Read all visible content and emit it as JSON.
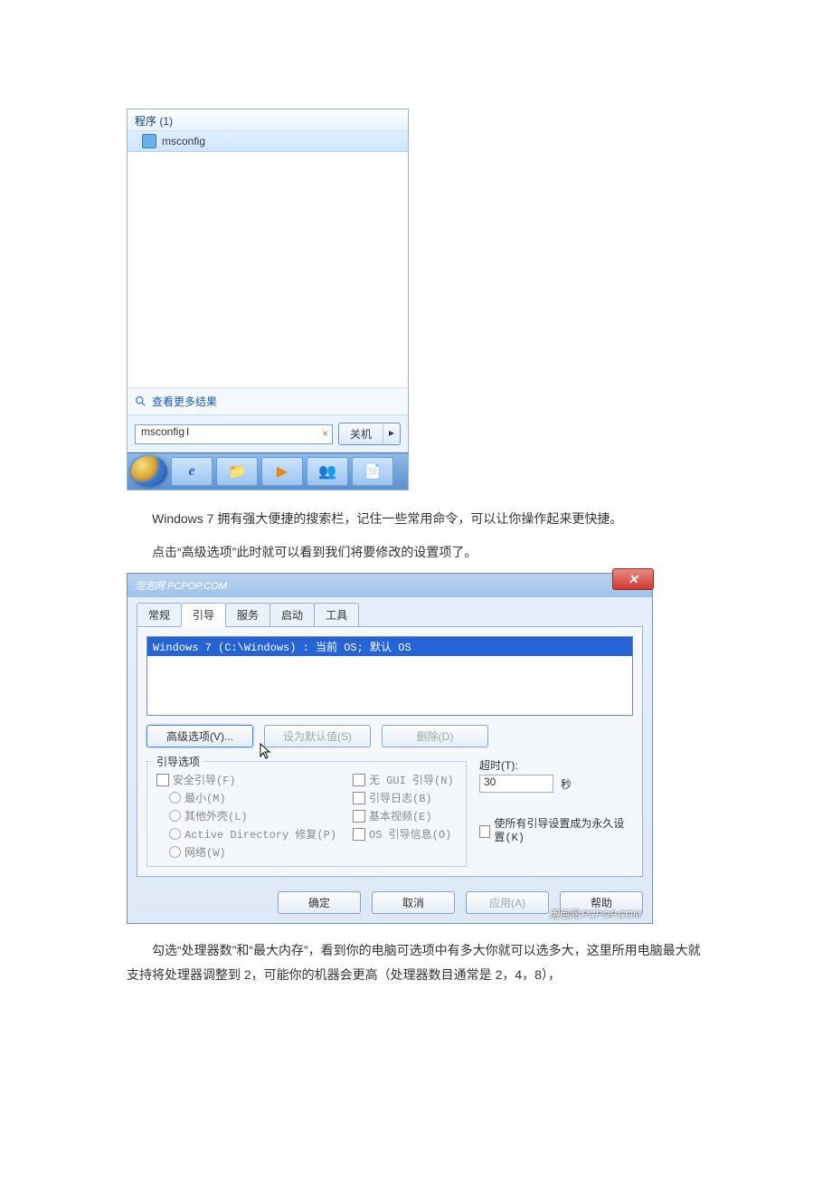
{
  "startmenu": {
    "programs_header": "程序 (1)",
    "result_label": "msconfig",
    "more_results": "查看更多结果",
    "search_value": "msconfig",
    "shutdown_label": "关机",
    "shutdown_more": "▸"
  },
  "taskbar_icons": {
    "ie": "e",
    "explorer": "📁",
    "wmp": "▶",
    "msn": "👥",
    "notepad": "📄"
  },
  "para1": "Windows 7 拥有强大便捷的搜索栏，记住一些常用命令，可以让你操作起来更快捷。",
  "para2": "点击“高级选项”此时就可以看到我们将要修改的设置项了。",
  "msconfig": {
    "title_wm": "泡泡网 PCPOP.COM",
    "close": "✕",
    "tabs": {
      "general": "常规",
      "boot": "引导",
      "services": "服务",
      "startup": "启动",
      "tools": "工具"
    },
    "os_entry": "Windows 7 (C:\\Windows) : 当前 OS; 默认 OS",
    "buttons": {
      "advanced": "高级选项(V)...",
      "set_default": "设为默认值(S)",
      "delete": "删除(D)"
    },
    "boot_group": {
      "legend": "引导选项",
      "safe_boot": "安全引导(F)",
      "minimal": "最小(M)",
      "altshell": "其他外壳(L)",
      "ad_repair": "Active Directory 修复(P)",
      "network": "网络(W)",
      "no_gui": "无 GUI 引导(N)",
      "boot_log": "引导日志(B)",
      "base_video": "基本视频(E)",
      "os_info": "OS 引导信息(O)"
    },
    "right": {
      "timeout_label": "超时(T):",
      "timeout_value": "30",
      "seconds": "秒",
      "permanent": "使所有引导设置成为永久设置(K)"
    },
    "footer": {
      "ok": "确定",
      "cancel": "取消",
      "apply": "应用(A)",
      "help": "帮助"
    },
    "wm": "泡泡网  PCPOP.COM"
  },
  "para3": "勾选“处理器数”和“最大内存”，看到你的电脑可选项中有多大你就可以选多大，这里所用电脑最大就支持将处理器调整到 2，可能你的机器会更高（处理器数目通常是 2，4，8），"
}
